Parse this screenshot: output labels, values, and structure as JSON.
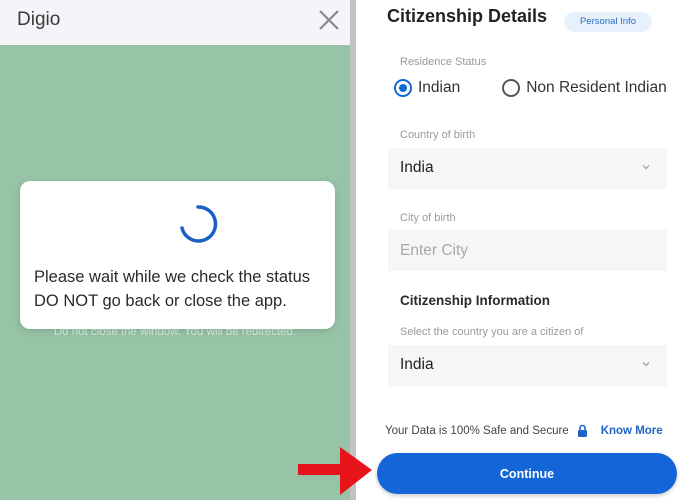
{
  "left_panel": {
    "title": "Digio",
    "close_icon": "close-icon",
    "modal": {
      "spinner_icon": "loading-spinner-icon",
      "message_line1": "Please wait while we check the status",
      "message_line2": "DO NOT go back or close the app."
    },
    "redirect_note": "Do not close the window. You will be redirected."
  },
  "right_panel": {
    "title": "Citizenship Details",
    "badge": "Personal Info",
    "residence_status": {
      "label": "Residence Status",
      "options": [
        {
          "label": "Indian",
          "checked": true
        },
        {
          "label": "Non Resident Indian",
          "checked": false
        }
      ]
    },
    "country_of_birth": {
      "label": "Country of birth",
      "value": "India"
    },
    "city_of_birth": {
      "label": "City of birth",
      "value": "",
      "placeholder": "Enter City"
    },
    "citizenship_information": {
      "title": "Citizenship Information",
      "label": "Select the country you are a citizen of",
      "value": "India"
    },
    "secure_note": "Your Data is 100% Safe and Secure",
    "know_more": "Know More",
    "continue_label": "Continue"
  },
  "colors": {
    "accent": "#1466d8",
    "overlay_green": "#97c4a6",
    "annotation_arrow": "#e8141b"
  }
}
